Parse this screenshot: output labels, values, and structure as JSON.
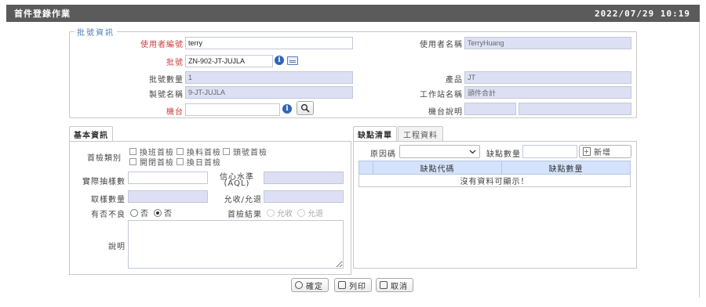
{
  "window": {
    "title": "首件登錄作業",
    "datetime": "2022/07/29 10:19"
  },
  "lot_info": {
    "legend": "批號資訊",
    "user_id": {
      "label": "使用者編號",
      "value": "terry"
    },
    "user_name": {
      "label": "使用者名稱",
      "value": "TerryHuang"
    },
    "lot_no": {
      "label": "批號",
      "value": "ZN-902-JT-JUJLA"
    },
    "lot_qty": {
      "label": "批號數量",
      "value": "1"
    },
    "product": {
      "label": "產品",
      "value": "JT"
    },
    "work_order_name": {
      "label": "製號名稱",
      "value": "9-JT-JUJLA"
    },
    "station_name": {
      "label": "工作站名稱",
      "value": "頭件合計"
    },
    "machine": {
      "label": "機台",
      "value": ""
    },
    "machine_desc": {
      "label": "機台說明",
      "value": ""
    }
  },
  "basic": {
    "tab_label": "基本資訊",
    "check_category": {
      "label": "首檢類別",
      "options": [
        "換班首檢",
        "換料首檢",
        "頭號首檢",
        "開閉首檢",
        "換日首檢"
      ]
    },
    "actual_sample": {
      "label": "實際抽樣數",
      "value": ""
    },
    "confidence": {
      "label": "信心水準",
      "label2": "(AQL)",
      "value": ""
    },
    "sample_count": {
      "label": "取樣數量",
      "value": ""
    },
    "allow_reject": {
      "label": "允收/允退",
      "value": ""
    },
    "has_defect": {
      "label": "有否不良",
      "opt_no": "否",
      "opt_yes": "否"
    },
    "result": {
      "label": "首檢結果",
      "opt_accept": "允收",
      "opt_reject": "允退"
    },
    "note": {
      "label": "說明"
    }
  },
  "defect": {
    "tab_defect": "缺點清單",
    "tab_engineering": "工程資料",
    "reason_label": "原因碼",
    "defect_qty_label": "缺點數量",
    "add_label": "新增",
    "columns": [
      "缺點代碼",
      "缺點數量"
    ],
    "empty_text": "沒有資料可顯示！"
  },
  "buttons": {
    "confirm": "確定",
    "print": "列印",
    "cancel": "取消"
  },
  "colors": {
    "titlebar": "#5b5b5b",
    "required_label": "#d23b3b",
    "readonly_field": "#dde0f4",
    "table_header": "#d4e2fb",
    "info_button": "#2e64b8"
  }
}
